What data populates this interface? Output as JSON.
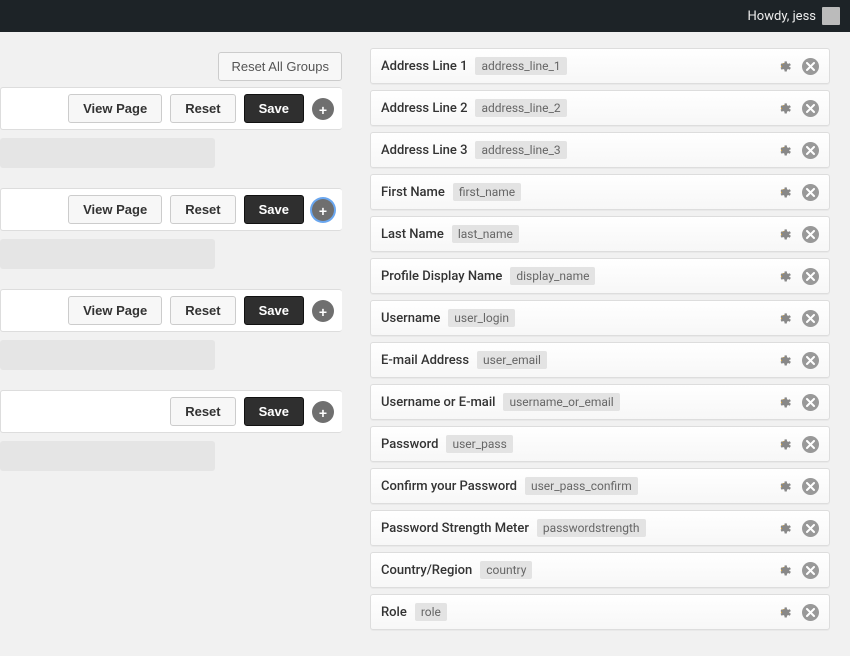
{
  "topbar": {
    "greeting": "Howdy, jess"
  },
  "labels": {
    "reset_all": "Reset All Groups",
    "view_page": "View Page",
    "reset": "Reset",
    "save": "Save"
  },
  "left_groups": [
    {
      "has_view_page": true,
      "highlight_add": false
    },
    {
      "has_view_page": true,
      "highlight_add": true
    },
    {
      "has_view_page": true,
      "highlight_add": false
    },
    {
      "has_view_page": false,
      "highlight_add": false
    }
  ],
  "fields": [
    {
      "label": "Address Line 1",
      "slug": "address_line_1"
    },
    {
      "label": "Address Line 2",
      "slug": "address_line_2"
    },
    {
      "label": "Address Line 3",
      "slug": "address_line_3"
    },
    {
      "label": "First Name",
      "slug": "first_name"
    },
    {
      "label": "Last Name",
      "slug": "last_name"
    },
    {
      "label": "Profile Display Name",
      "slug": "display_name"
    },
    {
      "label": "Username",
      "slug": "user_login"
    },
    {
      "label": "E-mail Address",
      "slug": "user_email"
    },
    {
      "label": "Username or E-mail",
      "slug": "username_or_email"
    },
    {
      "label": "Password",
      "slug": "user_pass"
    },
    {
      "label": "Confirm your Password",
      "slug": "user_pass_confirm"
    },
    {
      "label": "Password Strength Meter",
      "slug": "passwordstrength"
    },
    {
      "label": "Country/Region",
      "slug": "country"
    },
    {
      "label": "Role",
      "slug": "role"
    }
  ]
}
